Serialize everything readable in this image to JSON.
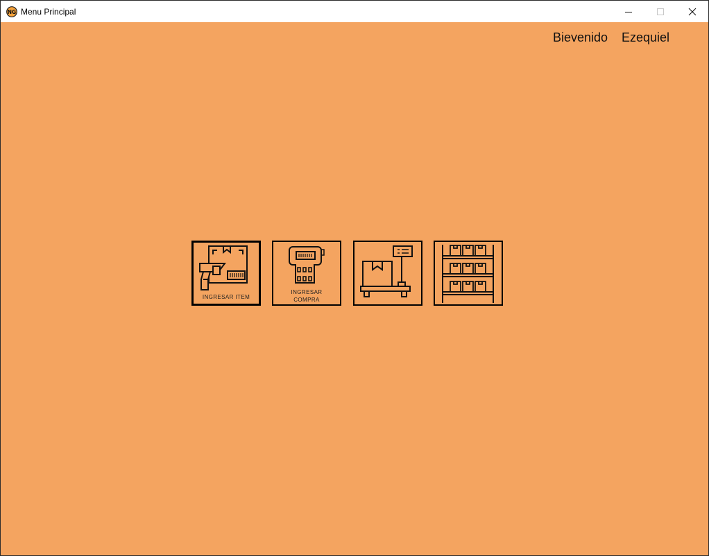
{
  "window": {
    "title": "Menu Principal",
    "icon": "ng-logo-icon",
    "controls": [
      "minimize-icon",
      "maximize-icon",
      "close-icon"
    ]
  },
  "header": {
    "welcome_label": "Bievenido",
    "user_name": "Ezequiel"
  },
  "menu": {
    "tiles": [
      {
        "id": "ingresar-item",
        "caption_lines": [
          "INGRESAR ITEM"
        ],
        "icon": "barcode-scanner-box-icon",
        "selected": true
      },
      {
        "id": "ingresar-compra",
        "caption_lines": [
          "INGRESAR",
          "COMPRA"
        ],
        "icon": "handheld-scanner-icon",
        "selected": false
      },
      {
        "id": "scale",
        "caption_lines": [],
        "icon": "package-scale-icon",
        "selected": false
      },
      {
        "id": "warehouse",
        "caption_lines": [],
        "icon": "warehouse-shelves-icon",
        "selected": false
      }
    ]
  },
  "colors": {
    "background": "#f4a460",
    "titlebar": "#ffffff",
    "icon_stroke": "#111111"
  }
}
